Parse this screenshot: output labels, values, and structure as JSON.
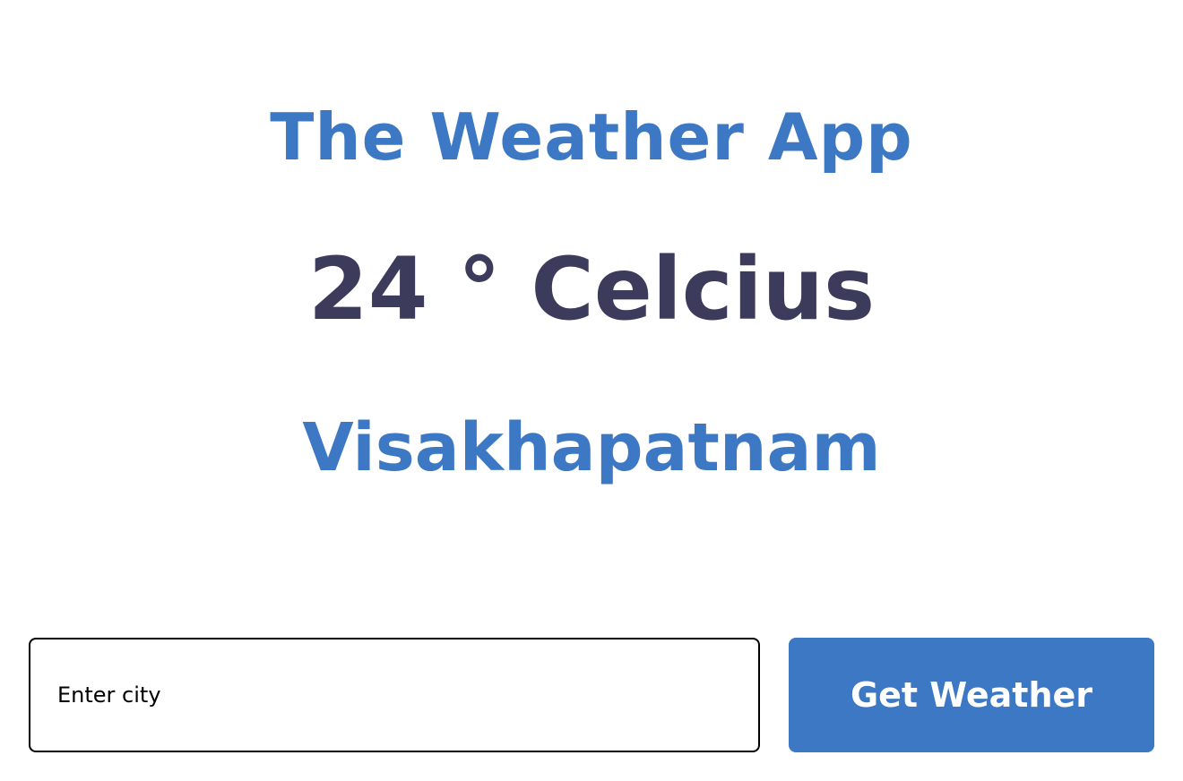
{
  "header": {
    "title": "The Weather App"
  },
  "weather": {
    "temperature_text": "24 ° Celcius",
    "city": "Visakhapatnam"
  },
  "search": {
    "placeholder": "Enter city",
    "value": "",
    "button_label": "Get Weather"
  },
  "colors": {
    "accent": "#3d78c4",
    "temperature_text": "#3c3b5c",
    "background": "#ffffff",
    "button_text": "#ffffff"
  }
}
